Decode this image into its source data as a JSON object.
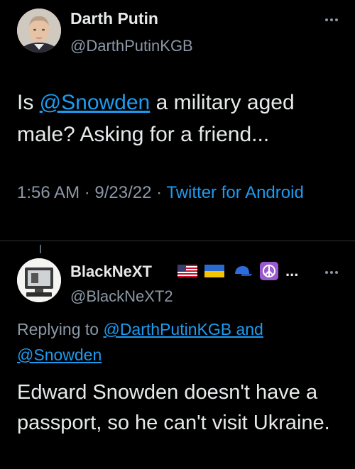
{
  "colors": {
    "background": "#000000",
    "text": "#e7e9ea",
    "secondary": "#8b98a5",
    "link": "#1d9bf0"
  },
  "main_tweet": {
    "author_name": "Darth Putin",
    "handle": "@DarthPutinKGB",
    "text_before": "Is ",
    "mention": "@Snowden",
    "text_after": " a military aged male? Asking for a friend...",
    "time": "1:56 AM",
    "separator": " · ",
    "date": "9/23/22",
    "source": "Twitter for Android",
    "more_icon": "more-horizontal-icon"
  },
  "reply": {
    "author_name": "BlackNeXT",
    "emojis": [
      "us-flag-icon",
      "ukraine-flag-icon",
      "blue-cap-icon",
      "peace-symbol-icon"
    ],
    "name_ellipsis": "...",
    "handle": "@BlackNeXT2",
    "replying_label": "Replying to ",
    "replying_to_1": "@DarthPutinKGB",
    "replying_and": " and",
    "replying_to_2": "@Snowden",
    "text": "Edward Snowden doesn't have a passport, so he can't visit Ukraine.",
    "more_icon": "more-horizontal-icon"
  }
}
